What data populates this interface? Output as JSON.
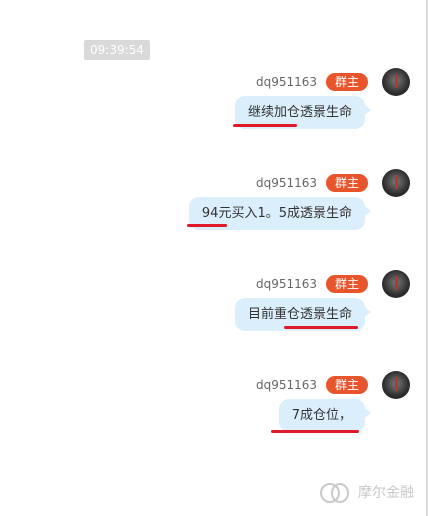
{
  "timestamp": "09:39:54",
  "messages": [
    {
      "username": "dq951163",
      "role": "群主",
      "text": "继续加仓透景生命"
    },
    {
      "username": "dq951163",
      "role": "群主",
      "text": "94元买入1。5成透景生命"
    },
    {
      "username": "dq951163",
      "role": "群主",
      "text": "目前重仓透景生命"
    },
    {
      "username": "dq951163",
      "role": "群主",
      "text": "7成仓位，"
    }
  ],
  "watermark": "摩尔金融",
  "colors": {
    "bubble": "#dbeefc",
    "badge": "#e8552d",
    "underline": "#e0192a"
  }
}
